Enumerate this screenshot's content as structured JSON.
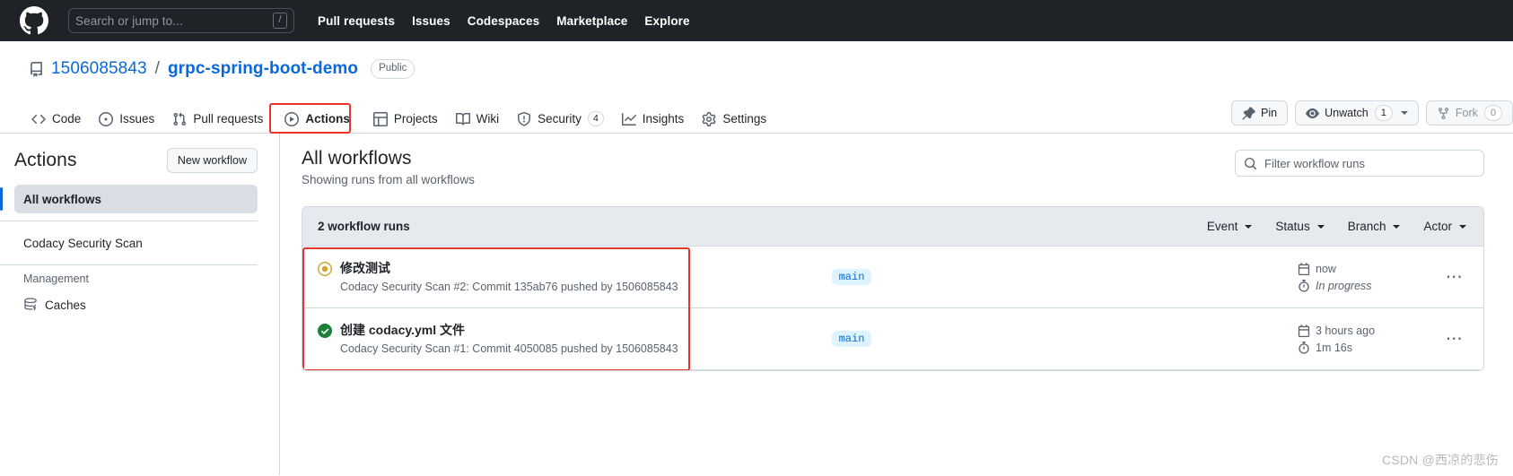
{
  "topbar": {
    "logo_icon": "github-mark-icon",
    "search": {
      "placeholder": "Search or jump to...",
      "shortcut_key": "/",
      "icon": "search-icon"
    },
    "nav": [
      {
        "label": "Pull requests"
      },
      {
        "label": "Issues"
      },
      {
        "label": "Codespaces"
      },
      {
        "label": "Marketplace"
      },
      {
        "label": "Explore"
      }
    ]
  },
  "repo": {
    "icon": "repo-icon",
    "owner": "1506085843",
    "separator": "/",
    "name": "grpc-spring-boot-demo",
    "visibility": "Public",
    "actions": [
      {
        "label": "Pin",
        "icon": "pin-icon",
        "count": null
      },
      {
        "label": "Unwatch",
        "icon": "eye-icon",
        "count": "1",
        "has_caret": true
      },
      {
        "label": "Fork",
        "icon": "fork-icon",
        "count": "0",
        "dimmed": true
      }
    ]
  },
  "repo_nav": {
    "tabs": [
      {
        "label": "Code",
        "icon": "code-icon",
        "active": false
      },
      {
        "label": "Issues",
        "icon": "issue-opened-icon",
        "active": false
      },
      {
        "label": "Pull requests",
        "icon": "git-pull-request-icon",
        "active": false
      },
      {
        "label": "Actions",
        "icon": "play-icon",
        "active": true,
        "annotated": true
      },
      {
        "label": "Projects",
        "icon": "table-icon",
        "active": false
      },
      {
        "label": "Wiki",
        "icon": "book-icon",
        "active": false
      },
      {
        "label": "Security",
        "icon": "shield-icon",
        "active": false,
        "count": "4"
      },
      {
        "label": "Insights",
        "icon": "graph-icon",
        "active": false
      },
      {
        "label": "Settings",
        "icon": "gear-icon",
        "active": false
      }
    ]
  },
  "sidebar": {
    "title": "Actions",
    "new_workflow_label": "New workflow",
    "items": [
      {
        "label": "All workflows",
        "selected": true
      },
      {
        "label": "Codacy Security Scan",
        "selected": false
      }
    ],
    "group_label": "Management",
    "management_items": [
      {
        "label": "Caches",
        "icon": "cache-icon"
      }
    ]
  },
  "main": {
    "title": "All workflows",
    "subtitle": "Showing runs from all workflows",
    "filter": {
      "placeholder": "Filter workflow runs",
      "icon": "search-icon"
    },
    "runs_count_label": "2 workflow runs",
    "filters": [
      {
        "label": "Event"
      },
      {
        "label": "Status"
      },
      {
        "label": "Branch"
      },
      {
        "label": "Actor"
      }
    ],
    "runs": [
      {
        "title": "修改测试",
        "description": "Codacy Security Scan #2: Commit 135ab76 pushed by 1506085843",
        "branch": "main",
        "status": "in_progress",
        "status_color": "#d4a72c",
        "time_ago": "now",
        "duration": "In progress",
        "duration_italic": true,
        "calendar_icon": "calendar-icon",
        "clock_icon": "stopwatch-icon",
        "menu_icon": "kebab-horizontal-icon"
      },
      {
        "title": "创建 codacy.yml 文件",
        "description": "Codacy Security Scan #1: Commit 4050085 pushed by 1506085843",
        "branch": "main",
        "status": "success",
        "status_color": "#1a7f37",
        "time_ago": "3 hours ago",
        "duration": "1m 16s",
        "duration_italic": false,
        "calendar_icon": "calendar-icon",
        "clock_icon": "stopwatch-icon",
        "menu_icon": "kebab-horizontal-icon"
      }
    ]
  },
  "watermark": {
    "text": "CSDN @西凉的悲伤"
  },
  "annotation": {
    "color": "#e8342a"
  }
}
